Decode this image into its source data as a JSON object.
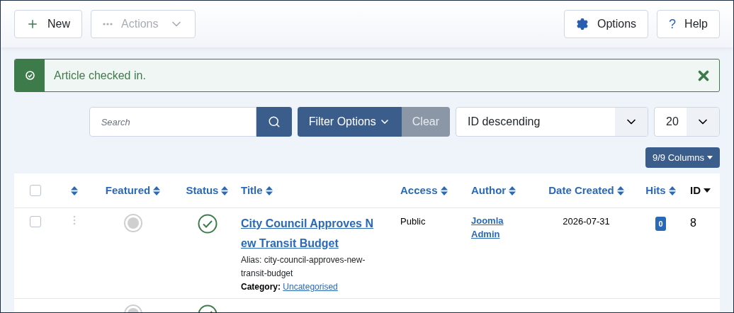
{
  "toolbar": {
    "left": [
      {
        "kind": "new",
        "label": "New",
        "disabled": false
      },
      {
        "kind": "actions",
        "label": "Actions",
        "disabled": true
      }
    ],
    "right": [
      {
        "kind": "options",
        "label": "Options"
      },
      {
        "kind": "help",
        "label": "Help",
        "icon": "?"
      }
    ]
  },
  "alert": {
    "message": "Article checked in."
  },
  "filters": {
    "search": {
      "placeholder": "Search"
    },
    "filter_button": "Filter Options",
    "clear_button": "Clear",
    "ordering": "ID descending",
    "limit": "20",
    "columns_button": "9/9 Columns"
  },
  "table": {
    "columns": [
      {
        "kind": "checkbox",
        "checked": false
      },
      {
        "kind": "ordering"
      },
      {
        "kind": "sort",
        "label": "Featured"
      },
      {
        "kind": "sort",
        "label": "Status"
      },
      {
        "kind": "sort",
        "label": "Title"
      },
      {
        "kind": "sort",
        "label": "Access"
      },
      {
        "kind": "sort",
        "label": "Author"
      },
      {
        "kind": "sort",
        "label": "Date Created"
      },
      {
        "kind": "sort",
        "label": "Hits"
      },
      {
        "kind": "active",
        "label": "ID"
      }
    ],
    "rows": [
      {
        "checked": false,
        "featured": false,
        "published": true,
        "title": "City Council Approves New Transit Budget",
        "alias_label": "Alias:",
        "alias": "city-council-approves-new-transit-budget",
        "category_label": "Category:",
        "category": "Uncategorised",
        "access": "Public",
        "author": "Joomla Admin",
        "date": "2026-07-31",
        "hits": "0",
        "id": "8"
      }
    ],
    "partial_row": {
      "featured": false,
      "published": true
    }
  }
}
